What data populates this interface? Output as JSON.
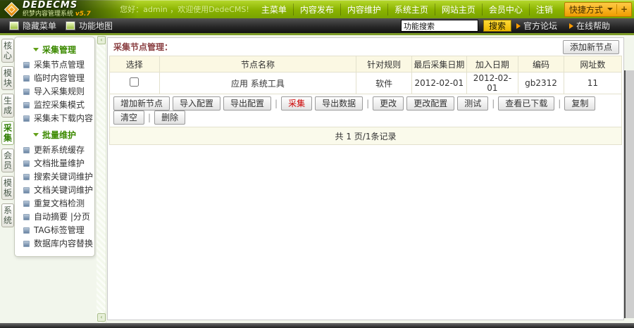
{
  "colors": {
    "header_green": "#8ab300",
    "accent_orange": "#ff9c00",
    "search_yellow": "#ecb800",
    "title_maroon": "#8b4043",
    "active_tab_green": "#2e7d00"
  },
  "header": {
    "brand": "DEDECMS",
    "subtitle": "织梦内容管理系统",
    "version": "v5.7",
    "welcome": "您好：admin ，欢迎使用DedeCMS!",
    "menu": [
      "主菜单",
      "内容发布",
      "内容维护",
      "系统主页",
      "网站主页",
      "会员中心",
      "注销"
    ],
    "quick_menu": "快捷方式",
    "quick_plus": "+"
  },
  "toolbar": {
    "hide_menu": "隐藏菜单",
    "function_map": "功能地图",
    "search_value": "功能搜索",
    "search_button": "搜索",
    "links": [
      "官方论坛",
      "在线帮助"
    ]
  },
  "module_tabs": [
    {
      "label": "核心",
      "active": false
    },
    {
      "label": "模块",
      "active": false
    },
    {
      "label": "生成",
      "active": false
    },
    {
      "label": "采集",
      "active": true
    },
    {
      "label": "会员",
      "active": false
    },
    {
      "label": "模板",
      "active": false
    },
    {
      "label": "系统",
      "active": false
    }
  ],
  "sidebar": {
    "groups": [
      {
        "title": "采集管理",
        "items": [
          "采集节点管理",
          "临时内容管理",
          "导入采集规则",
          "监控采集模式",
          "采集未下载内容"
        ]
      },
      {
        "title": "批量维护",
        "items": [
          "更新系统缓存",
          "文档批量维护",
          "搜索关键词维护",
          "文档关键词维护",
          "重复文档检测",
          "自动摘要 |分页",
          "TAG标签管理",
          "数据库内容替换"
        ]
      }
    ]
  },
  "main": {
    "title": "采集节点管理：",
    "add_button": "添加新节点",
    "table": {
      "headers": [
        "选择",
        "节点名称",
        "针对规则",
        "最后采集日期",
        "加入日期",
        "编码",
        "网址数"
      ],
      "rows": [
        {
          "name": "应用 系统工具",
          "rule": "软件",
          "last_collect_date": "2012-02-01",
          "join_date": "2012-02-01",
          "encoding": "gb2312",
          "url_count": "11",
          "checked": false
        }
      ]
    },
    "action_groups": [
      [
        {
          "label": "增加新节点"
        },
        {
          "label": "导入配置"
        },
        {
          "label": "导出配置"
        }
      ],
      [
        {
          "label": "采集",
          "highlight": true
        },
        {
          "label": "导出数据"
        }
      ],
      [
        {
          "label": "更改"
        },
        {
          "label": "更改配置"
        },
        {
          "label": "测试"
        }
      ],
      [
        {
          "label": "查看已下载"
        }
      ],
      [
        {
          "label": "复制"
        },
        {
          "label": "清空"
        }
      ],
      [
        {
          "label": "删除"
        }
      ]
    ],
    "pagination": "共 1 页/1条记录"
  }
}
